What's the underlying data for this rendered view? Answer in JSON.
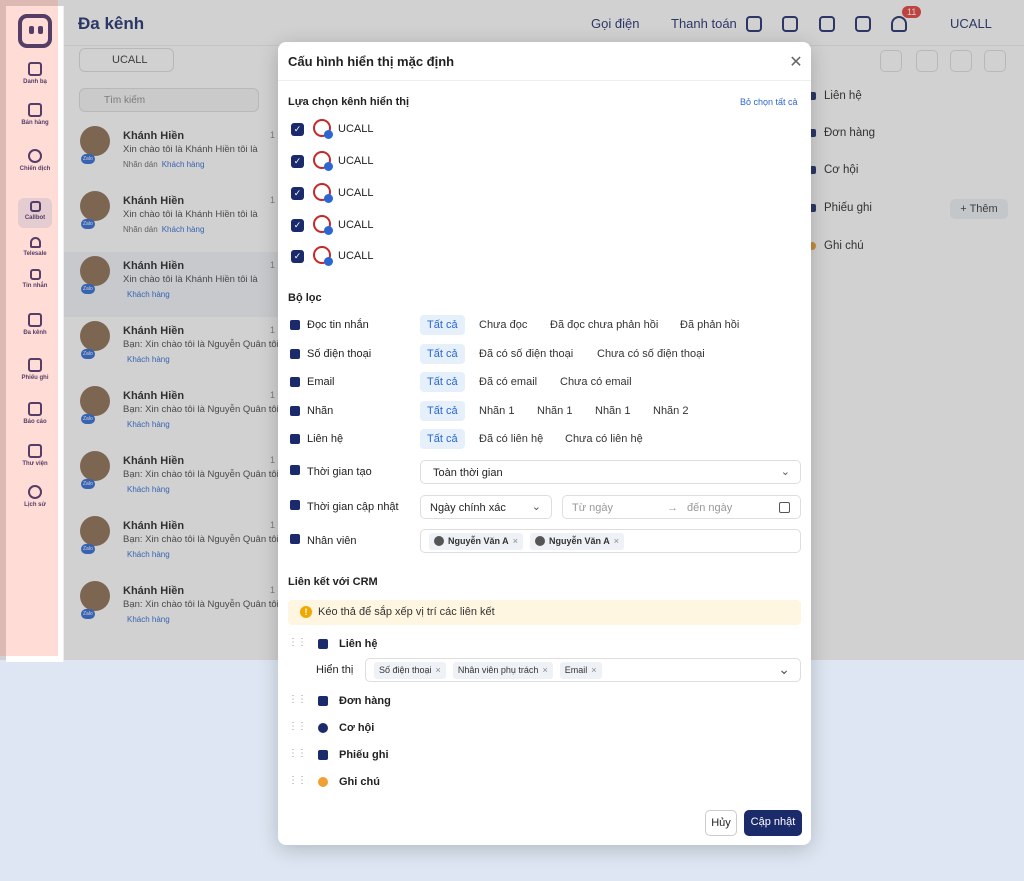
{
  "header": {
    "title": "Đa kênh",
    "call": "Gọi điện",
    "pay": "Thanh toán",
    "notif_count": "11",
    "account": "UCALL"
  },
  "sidebar": {
    "items": [
      {
        "label": "Danh bạ"
      },
      {
        "label": "Bán hàng"
      },
      {
        "label": "Chiến dịch"
      },
      {
        "label": "Callbot"
      },
      {
        "label": "Telesale"
      },
      {
        "label": "Tin nhắn"
      },
      {
        "label": "Đa kênh"
      },
      {
        "label": "Phiếu ghi"
      },
      {
        "label": "Báo cáo"
      },
      {
        "label": "Thư viện"
      },
      {
        "label": "Lịch sử"
      }
    ]
  },
  "list": {
    "account": "UCALL",
    "search_placeholder": "Tìm kiếm",
    "conversations": [
      {
        "name": "Khánh Hiền",
        "time": "1",
        "msg": "Xin chào tôi là Khánh Hiền tôi là",
        "sticky": "Nhãn dán",
        "tag": "Khách hàng",
        "zalo": "Zalo"
      },
      {
        "name": "Khánh Hiền",
        "time": "1",
        "msg": "Xin chào tôi là Khánh Hiền tôi là",
        "sticky": "Nhãn dán",
        "tag": "Khách hàng",
        "zalo": "Zalo"
      },
      {
        "name": "Khánh Hiền",
        "time": "1",
        "msg": "Xin chào tôi là Khánh Hiền tôi là",
        "sticky": "",
        "tag": "Khách hàng",
        "zalo": "Zalo"
      },
      {
        "name": "Khánh Hiền",
        "time": "1",
        "msg": "Bạn: Xin chào tôi là Nguyễn Quân tôi",
        "sticky": "",
        "tag": "Khách hàng",
        "zalo": "Zalo"
      },
      {
        "name": "Khánh Hiền",
        "time": "1",
        "msg": "Bạn: Xin chào tôi là Nguyễn Quân tôi",
        "sticky": "",
        "tag": "Khách hàng",
        "zalo": "Zalo"
      },
      {
        "name": "Khánh Hiền",
        "time": "1",
        "msg": "Bạn: Xin chào tôi là Nguyễn Quân tôi",
        "sticky": "",
        "tag": "Khách hàng",
        "zalo": "Zalo"
      },
      {
        "name": "Khánh Hiền",
        "time": "1",
        "msg": "Bạn: Xin chào tôi là Nguyễn Quân tôi",
        "sticky": "",
        "tag": "Khách hàng",
        "zalo": "Zalo"
      },
      {
        "name": "Khánh Hiền",
        "time": "1",
        "msg": "Bạn: Xin chào tôi là Nguyễn Quân tôi",
        "sticky": "",
        "tag": "Khách hàng",
        "zalo": "Zalo"
      }
    ]
  },
  "right": {
    "items": [
      "Liên hệ",
      "Đơn hàng",
      "Cơ hội",
      "Phiếu ghi",
      "Ghi chú"
    ],
    "add": "Thêm"
  },
  "modal": {
    "title": "Cấu hình hiển thị mặc định",
    "channel_section": "Lựa chọn kênh hiển thị",
    "deselect_all": "Bỏ chọn tất cả",
    "channels": [
      "UCALL",
      "UCALL",
      "UCALL",
      "UCALL",
      "UCALL"
    ],
    "filter_section": "Bộ lọc",
    "filters": [
      {
        "label": "Đọc tin nhắn",
        "options": [
          "Tất cả",
          "Chưa đọc",
          "Đã đọc chưa phản hồi",
          "Đã phản hồi"
        ]
      },
      {
        "label": "Số điện thoại",
        "options": [
          "Tất cả",
          "Đã có số điện thoại",
          "Chưa có số điện thoại"
        ]
      },
      {
        "label": "Email",
        "options": [
          "Tất cả",
          "Đã có email",
          "Chưa có email"
        ]
      },
      {
        "label": "Nhãn",
        "options": [
          "Tất cả",
          "Nhãn 1",
          "Nhãn 1",
          "Nhãn 1",
          "Nhãn 2"
        ]
      },
      {
        "label": "Liên hệ",
        "options": [
          "Tất cả",
          "Đã có liên hệ",
          "Chưa có liên hệ"
        ]
      }
    ],
    "created_time": {
      "label": "Thời gian tạo",
      "value": "Toàn thời gian"
    },
    "updated_time": {
      "label": "Thời gian cập nhật",
      "mode": "Ngày chính xác",
      "from": "Từ ngày",
      "to": "đến ngày"
    },
    "staff": {
      "label": "Nhân viên",
      "tags": [
        "Nguyễn Văn A",
        "Nguyễn Văn A"
      ]
    },
    "crm_section": "Liên kết với CRM",
    "crm_hint": "Kéo thả để sắp xếp vị trí các liên kết",
    "crm_items": [
      "Liên hệ",
      "Đơn hàng",
      "Cơ hội",
      "Phiếu ghi",
      "Ghi chú"
    ],
    "display_label": "Hiển thị",
    "display_tags": [
      "Số điện thoại",
      "Nhân viên phụ trách",
      "Email"
    ],
    "cancel": "Hủy",
    "update": "Cập nhật"
  }
}
